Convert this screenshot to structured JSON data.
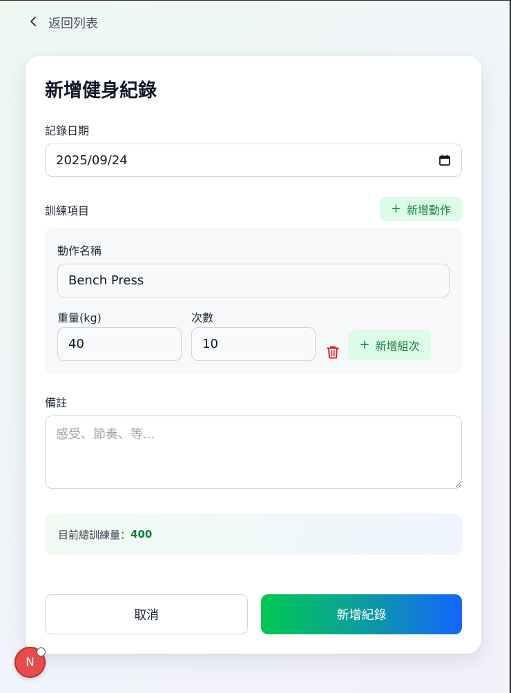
{
  "nav": {
    "back_label": "返回列表"
  },
  "form": {
    "title": "新增健身紀錄",
    "date": {
      "label": "記錄日期",
      "value": "2025/09/24"
    },
    "exercises": {
      "label": "訓練項目",
      "add_button": "新增動作",
      "items": [
        {
          "name_label": "動作名稱",
          "name_value": "Bench Press",
          "weight_label": "重量(kg)",
          "weight_value": "40",
          "reps_label": "次數",
          "reps_value": "10",
          "add_set_button": "新增組次"
        }
      ]
    },
    "notes": {
      "label": "備註",
      "placeholder": "感受、節奏、等..."
    },
    "summary": {
      "label": "目前總訓練量：",
      "value": "400"
    },
    "actions": {
      "cancel": "取消",
      "submit": "新增紀錄"
    }
  },
  "badge": {
    "letter": "N"
  },
  "colors": {
    "accent_green": "#15803d",
    "soft_green": "#dcfce7",
    "danger": "#dc2626",
    "gradient_start": "#00c853",
    "gradient_end": "#1565ff"
  },
  "icons": {
    "back": "chevron-left-icon",
    "calendar": "calendar-icon",
    "add": "plus-icon",
    "delete": "trash-icon"
  }
}
